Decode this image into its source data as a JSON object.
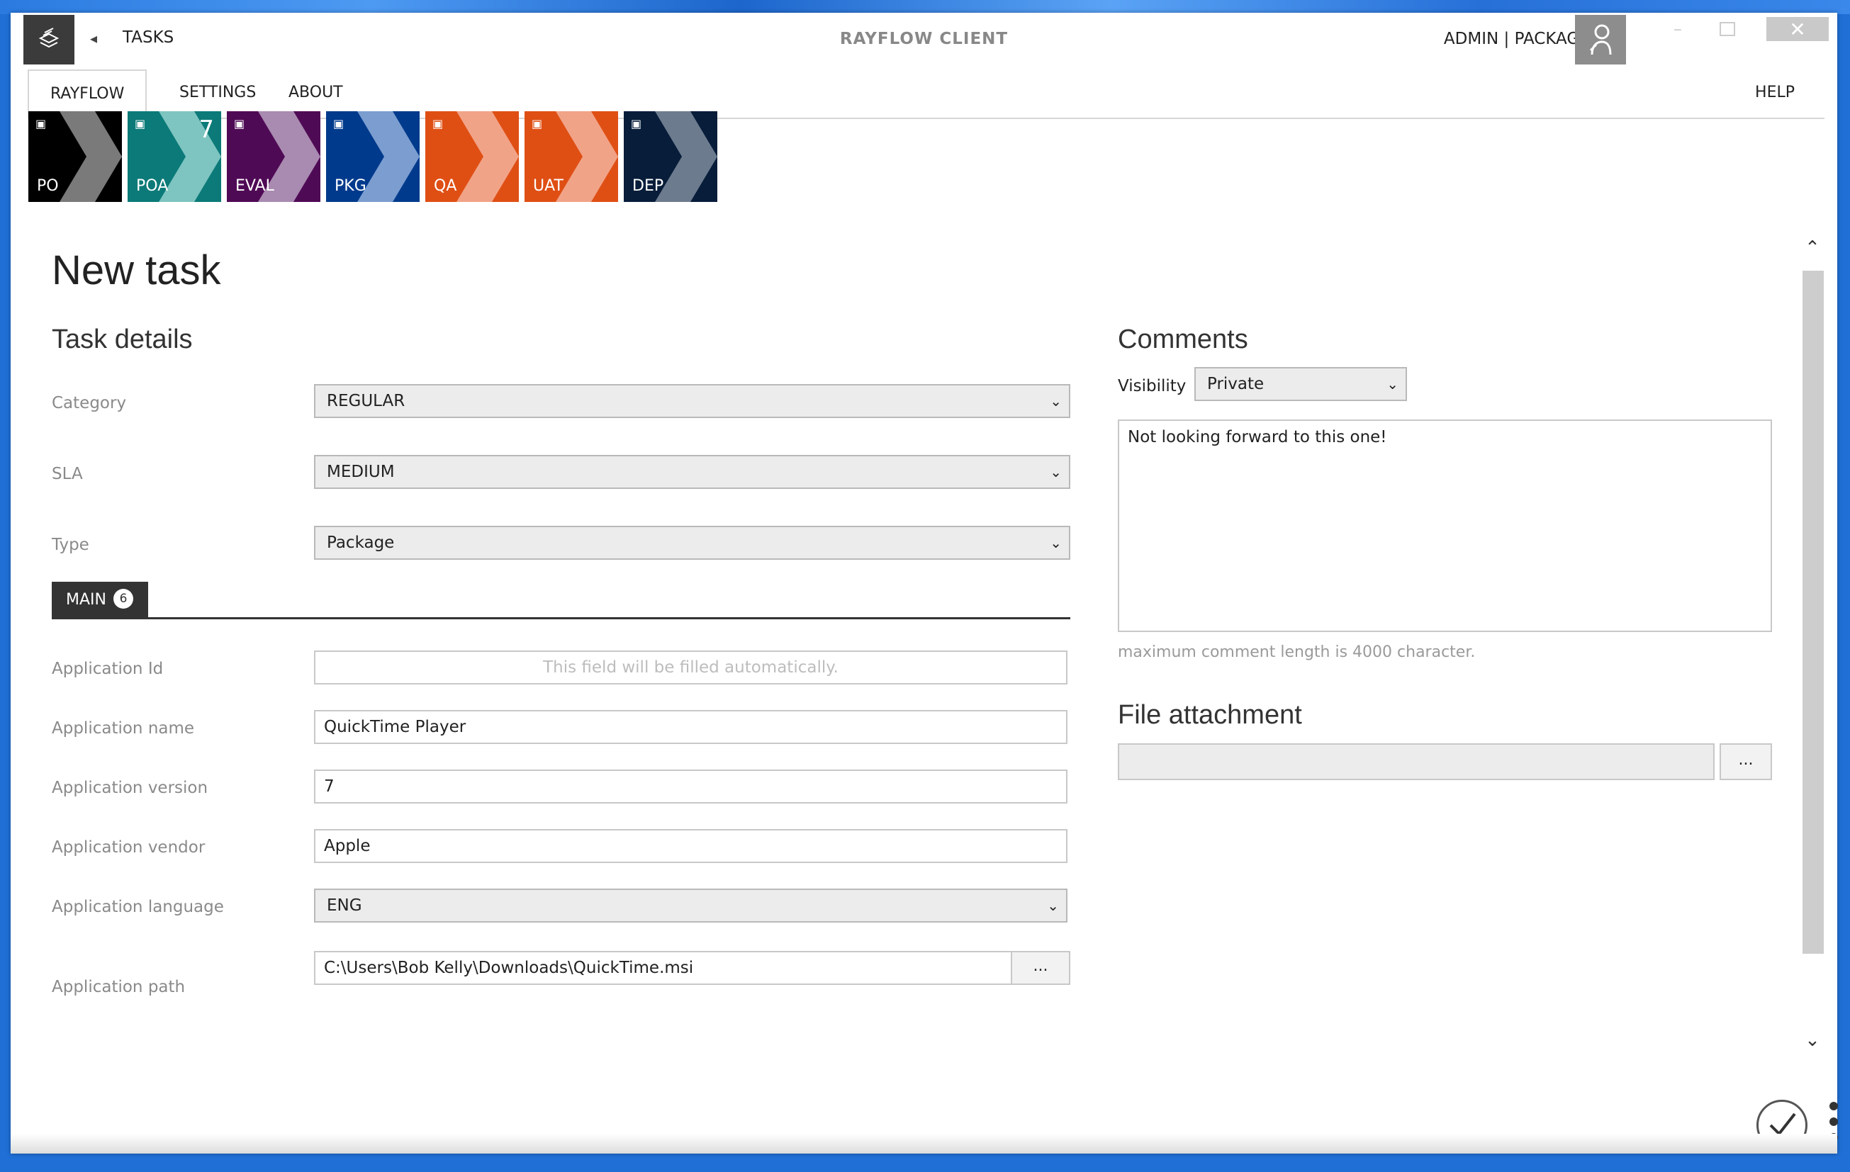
{
  "titlebar": {
    "nav_title": "TASKS",
    "window_title": "RAYFLOW CLIENT",
    "user_label": "ADMIN | PACKAGING"
  },
  "menu": {
    "items": [
      "RAYFLOW",
      "SETTINGS",
      "ABOUT"
    ],
    "help": "HELP"
  },
  "tiles": [
    {
      "label": "PO",
      "count": "",
      "color": "#000000",
      "chev": "#7a7a7a"
    },
    {
      "label": "POA",
      "count": "7",
      "color": "#0b7a78",
      "chev": "#7ec4c0"
    },
    {
      "label": "EVAL",
      "count": "",
      "color": "#4f0a55",
      "chev": "#a98ab0"
    },
    {
      "label": "PKG",
      "count": "",
      "color": "#003a8c",
      "chev": "#7b9dd0"
    },
    {
      "label": "QA",
      "count": "",
      "color": "#df4f14",
      "chev": "#f1a387"
    },
    {
      "label": "UAT",
      "count": "",
      "color": "#df4f14",
      "chev": "#f1a387"
    },
    {
      "label": "DEP",
      "count": "",
      "color": "#071d3a",
      "chev": "#6d7b8e"
    }
  ],
  "page": {
    "title": "New task",
    "task_details_title": "Task details",
    "category_label": "Category",
    "category_value": "REGULAR",
    "sla_label": "SLA",
    "sla_value": "MEDIUM",
    "type_label": "Type",
    "type_value": "Package",
    "tab_main_label": "MAIN",
    "tab_main_count": "6",
    "app_id_label": "Application Id",
    "app_id_placeholder": "This field will be filled automatically.",
    "app_name_label": "Application name",
    "app_name_value": "QuickTime Player",
    "app_version_label": "Application version",
    "app_version_value": "7",
    "app_vendor_label": "Application vendor",
    "app_vendor_value": "Apple",
    "app_language_label": "Application language",
    "app_language_value": "ENG",
    "app_path_label": "Application path",
    "app_path_value": "C:\\Users\\Bob Kelly\\Downloads\\QuickTime.msi",
    "browse_label": "..."
  },
  "comments": {
    "title": "Comments",
    "visibility_label": "Visibility",
    "visibility_value": "Private",
    "text": "Not looking forward to this one!",
    "hint": "maximum comment length is 4000 character."
  },
  "attachment": {
    "title": "File attachment",
    "browse_label": "..."
  },
  "icons": {
    "back": "back-arrow-icon",
    "close": "close-icon",
    "confirm": "checkmark-icon",
    "more": "more-vertical-icon"
  }
}
